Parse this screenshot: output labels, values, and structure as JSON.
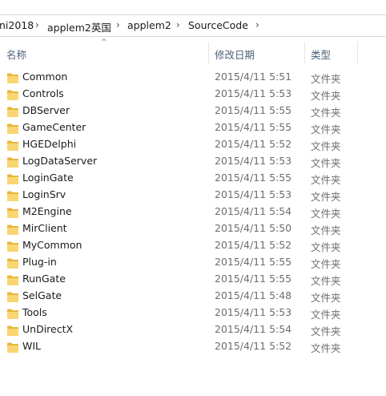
{
  "breadcrumb": {
    "items": [
      "ni2018",
      "applem2英国",
      "applem2",
      "SourceCode"
    ]
  },
  "columns": {
    "name": "名称",
    "date": "修改日期",
    "type": "类型"
  },
  "files": [
    {
      "name": "Common",
      "date": "2015/4/11 5:51",
      "type": "文件夹"
    },
    {
      "name": "Controls",
      "date": "2015/4/11 5:53",
      "type": "文件夹"
    },
    {
      "name": "DBServer",
      "date": "2015/4/11 5:55",
      "type": "文件夹"
    },
    {
      "name": "GameCenter",
      "date": "2015/4/11 5:55",
      "type": "文件夹"
    },
    {
      "name": "HGEDelphi",
      "date": "2015/4/11 5:52",
      "type": "文件夹"
    },
    {
      "name": "LogDataServer",
      "date": "2015/4/11 5:53",
      "type": "文件夹"
    },
    {
      "name": "LoginGate",
      "date": "2015/4/11 5:55",
      "type": "文件夹"
    },
    {
      "name": "LoginSrv",
      "date": "2015/4/11 5:53",
      "type": "文件夹"
    },
    {
      "name": "M2Engine",
      "date": "2015/4/11 5:54",
      "type": "文件夹"
    },
    {
      "name": "MirClient",
      "date": "2015/4/11 5:50",
      "type": "文件夹"
    },
    {
      "name": "MyCommon",
      "date": "2015/4/11 5:52",
      "type": "文件夹"
    },
    {
      "name": "Plug-in",
      "date": "2015/4/11 5:55",
      "type": "文件夹"
    },
    {
      "name": "RunGate",
      "date": "2015/4/11 5:55",
      "type": "文件夹"
    },
    {
      "name": "SelGate",
      "date": "2015/4/11 5:48",
      "type": "文件夹"
    },
    {
      "name": "Tools",
      "date": "2015/4/11 5:53",
      "type": "文件夹"
    },
    {
      "name": "UnDirectX",
      "date": "2015/4/11 5:54",
      "type": "文件夹"
    },
    {
      "name": "WIL",
      "date": "2015/4/11 5:52",
      "type": "文件夹"
    }
  ]
}
